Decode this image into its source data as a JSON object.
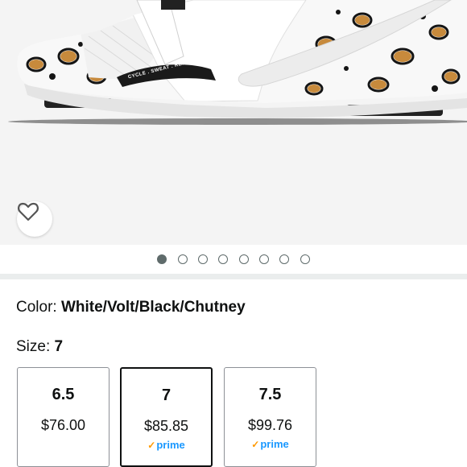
{
  "product": {
    "image_alt": "white cycling shoe with leopard print",
    "strap_text": "CYCLE . SWEAT . REPEAT",
    "wishlist_icon": "heart-outline-icon"
  },
  "carousel": {
    "count": 8,
    "active_index": 0
  },
  "color": {
    "label": "Color: ",
    "value": "White/Volt/Black/Chutney"
  },
  "size": {
    "label": "Size: ",
    "value": "7",
    "options": [
      {
        "size": "6.5",
        "price": "$76.00",
        "prime": ""
      },
      {
        "size": "7",
        "price": "$85.85",
        "prime": "prime"
      },
      {
        "size": "7.5",
        "price": "$99.76",
        "prime": "prime"
      }
    ]
  },
  "colors": {
    "prime_blue": "#1a98ff",
    "prime_check": "#ff9900",
    "selected_border": "#0f1111"
  }
}
